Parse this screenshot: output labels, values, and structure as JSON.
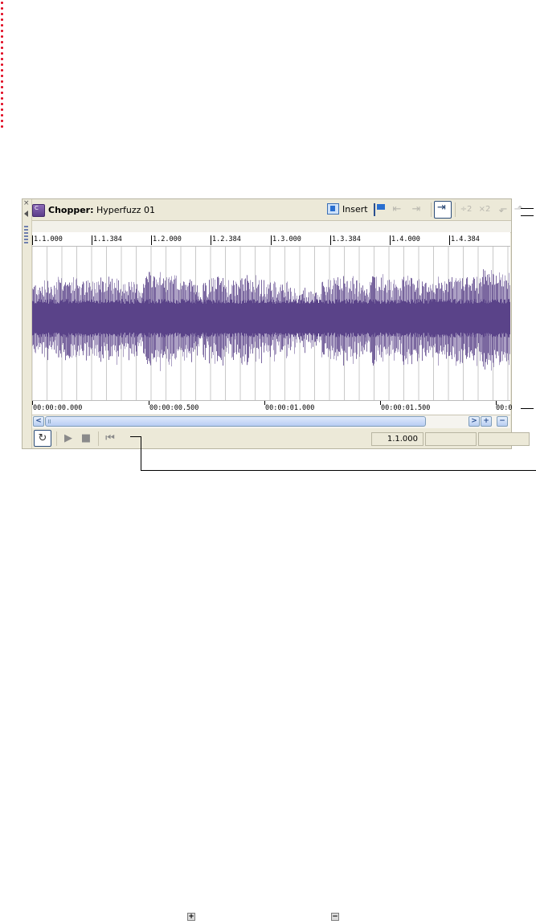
{
  "window": {
    "title_bold": "Chopper:",
    "title_name": " Hyperfuzz 01",
    "insert_label": "Insert"
  },
  "ruler": {
    "labels": [
      "1.1.000",
      "1.1.384",
      "1.2.000",
      "1.2.384",
      "1.3.000",
      "1.3.384",
      "1.4.000",
      "1.4.384"
    ]
  },
  "timescale": {
    "labels": [
      "00:00:00.000",
      "00:00:00.500",
      "00:00:01.000",
      "00:00:01.500",
      "00:0"
    ]
  },
  "status": {
    "position": "1.1.000",
    "field2": "",
    "field3": ""
  },
  "glyphs": {
    "close": "×",
    "scroll_left": "<",
    "scroll_right": ">",
    "zoom_in": "+",
    "zoom_out": "−",
    "loop": "↻",
    "play": "▶",
    "stop": "■",
    "rewind": "⏮",
    "page_zoom_in": "+",
    "page_zoom_out": "−"
  },
  "colors": {
    "waveform": "#5a4389",
    "accent": "#2a6fd0"
  }
}
